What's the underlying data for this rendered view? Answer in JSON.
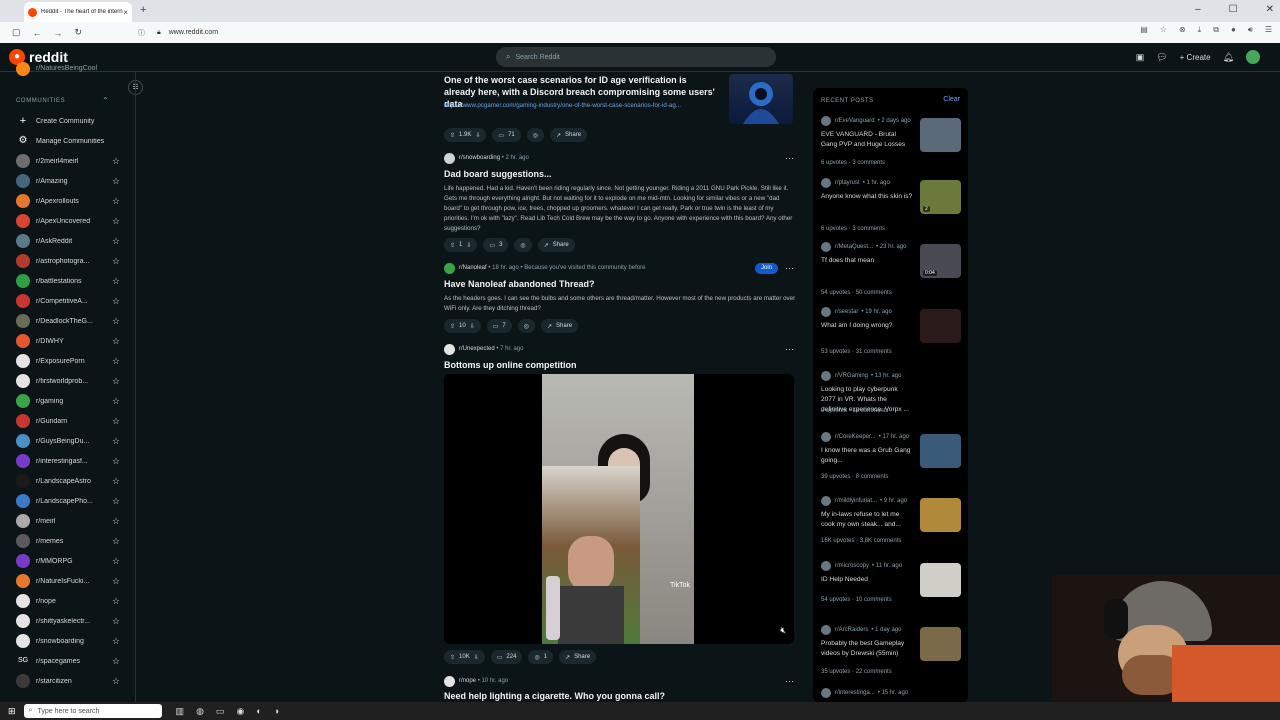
{
  "browser": {
    "tab_title": "Reddit - The heart of the intern",
    "tab_close": "×",
    "new_tab": "+",
    "url": "www.reddit.com",
    "window_buttons": [
      "–",
      "☐",
      "✕"
    ]
  },
  "header": {
    "logo_text": "reddit",
    "search_placeholder": "Search Reddit",
    "create_label": "Create",
    "notification_count": "1"
  },
  "sidebar": {
    "cut_item": "r/NaturesBeingCool",
    "section_label": "COMMUNITIES",
    "create_community": "Create Community",
    "manage_communities": "Manage Communities",
    "communities": [
      {
        "name": "r/2meirl4meirl",
        "color": "#6d6d6d",
        "glyph": ""
      },
      {
        "name": "r/Amazing",
        "color": "#46667a",
        "glyph": ""
      },
      {
        "name": "r/Apexrollouts",
        "color": "#e8772e",
        "glyph": ""
      },
      {
        "name": "r/ApexUncovered",
        "color": "#d64532",
        "glyph": ""
      },
      {
        "name": "r/AskReddit",
        "color": "#5a7a8a",
        "glyph": ""
      },
      {
        "name": "r/astrophotogra...",
        "color": "#b33b2c",
        "glyph": ""
      },
      {
        "name": "r/battlestations",
        "color": "#2ea043",
        "glyph": ""
      },
      {
        "name": "r/CompetitiveA...",
        "color": "#c8372d",
        "glyph": ""
      },
      {
        "name": "r/DeadlockTheG...",
        "color": "#6b6b5a",
        "glyph": ""
      },
      {
        "name": "r/DIWHY",
        "color": "#e8562e",
        "glyph": ""
      },
      {
        "name": "r/ExposurePorn",
        "color": "#e4e4e4",
        "glyph": ""
      },
      {
        "name": "r/firstworldprob...",
        "color": "#e4e4e4",
        "glyph": ""
      },
      {
        "name": "r/gaming",
        "color": "#3aa547",
        "glyph": ""
      },
      {
        "name": "r/Gundam",
        "color": "#c8372d",
        "glyph": ""
      },
      {
        "name": "r/GuysBeingDu...",
        "color": "#4a90c8",
        "glyph": ""
      },
      {
        "name": "r/interestingasf...",
        "color": "#7a3ac8",
        "glyph": ""
      },
      {
        "name": "r/LandscapeAstro",
        "color": "#1a1a1a",
        "glyph": ""
      },
      {
        "name": "r/LandscapePho...",
        "color": "#3a7ac8",
        "glyph": ""
      },
      {
        "name": "r/meirl",
        "color": "#aaaaaa",
        "glyph": ""
      },
      {
        "name": "r/memes",
        "color": "#5a5a5a",
        "glyph": ""
      },
      {
        "name": "r/MMORPG",
        "color": "#7a3ac8",
        "glyph": ""
      },
      {
        "name": "r/NatureIsFucki...",
        "color": "#e8772e",
        "glyph": ""
      },
      {
        "name": "r/nope",
        "color": "#e4e4e4",
        "glyph": ""
      },
      {
        "name": "r/shittyaskelectr...",
        "color": "#e4e4e4",
        "glyph": ""
      },
      {
        "name": "r/snowboarding",
        "color": "#e4e4e4",
        "glyph": ""
      },
      {
        "name": "r/spacegames",
        "color": "#0b1416",
        "glyph": "SG"
      },
      {
        "name": "r/starcitizen",
        "color": "#3a3a3a",
        "glyph": ""
      }
    ]
  },
  "feed": {
    "posts": [
      {
        "title": "One of the worst case scenarios for ID age verification is already here, with a Discord breach compromising some users' data",
        "link": "https://www.pcgamer.com/gaming-industry/one-of-the-worst-case-scenarios-for-id-ag...",
        "votes": "1.9K",
        "comments": "71",
        "share": "Share"
      },
      {
        "sub": "r/snowboarding",
        "time": "• 2 hr. ago",
        "title": "Dad board suggestions...",
        "body": "Life happened. Had a kid. Haven't been riding regularly since. Not getting younger. Riding a 2011 GNU Park Pickle. Still like it. Gets me through everything alright. But not waiting for it to explode on me mid-mtn. Looking for similar vibes or a new \"dad board\" to get through pow, ice, trees, chopped up groomers. whatever I can get really. Park or true twin is the least of my priorities. I'm ok with \"lazy\". Read Lib Tech Cold Brew may be the way to go. Anyone with experience with this board? Any other suggestions?",
        "votes": "1",
        "comments": "3",
        "share": "Share"
      },
      {
        "sub": "r/Nanoleaf",
        "time": "• 18 hr. ago • Because you've visited this community before",
        "join": "Join",
        "title": "Have Nanoleaf abandoned Thread?",
        "body": "As the headers goes. I can see the bulbs and some others are thread/matter. However most of the new products are matter over WiFi only. Are they ditching thread?",
        "votes": "10",
        "comments": "7",
        "share": "Share"
      },
      {
        "sub": "r/Unexpected",
        "time": "• 7 hr. ago",
        "title": "Bottoms up online competition",
        "tiktok": "TikTok",
        "votes": "10K",
        "comments": "224",
        "award": "1",
        "share": "Share"
      },
      {
        "sub": "r/nope",
        "time": "• 10 hr. ago",
        "title": "Need help lighting a cigarette. Who you gonna call?"
      }
    ]
  },
  "recent": {
    "heading": "RECENT POSTS",
    "clear": "Clear",
    "items": [
      {
        "sub": "r/EveVanguard",
        "time": "• 2 days ago",
        "title": "EVE VANGUARD - Brutal Gang PVP and Huge Losses",
        "upvotes": "6 upvotes",
        "comments": "3 comments",
        "thumb": "#5a6a78"
      },
      {
        "sub": "r/playrust",
        "time": "• 1 hr. ago",
        "title": "Anyone know what this skin is?",
        "upvotes": "6 upvotes",
        "comments": "3 comments",
        "thumb": "#6b7a3a",
        "badge": "2"
      },
      {
        "sub": "r/MetaQuest...",
        "time": "• 23 hr. ago",
        "title": "Tf does that mean",
        "upvotes": "54 upvotes",
        "comments": "50 comments",
        "thumb": "#4a4a55",
        "badge": "0:04"
      },
      {
        "sub": "r/seestar",
        "time": "• 19 hr. ago",
        "title": "What am I doing wrong?",
        "upvotes": "53 upvotes",
        "comments": "31 comments",
        "thumb": "#2a1a1a"
      },
      {
        "sub": "r/VRGaming",
        "time": "• 13 hr. ago",
        "title": "Looking to play cyberpunk 2077 in VR. Whats the definitive experience. Vorpx ...",
        "upvotes": "2 upvotes",
        "comments": "16 comments"
      },
      {
        "sub": "r/CoreKeeper...",
        "time": "• 17 hr. ago",
        "title": "I know there was a Grub Gang going...",
        "upvotes": "39 upvotes",
        "comments": "8 comments",
        "thumb": "#3a5a7a"
      },
      {
        "sub": "r/mildlyinfuriat...",
        "time": "• 9 hr. ago",
        "title": "My in-laws refuse to let me cook my own steak... and...",
        "upvotes": "16K upvotes",
        "comments": "3.8K comments",
        "thumb": "#b08a3a"
      },
      {
        "sub": "r/microscopy",
        "time": "• 11 hr. ago",
        "title": "ID Help Needed",
        "upvotes": "54 upvotes",
        "comments": "10 comments",
        "thumb": "#cfcfc8"
      },
      {
        "sub": "r/ArcRaiders",
        "time": "• 1 day ago",
        "title": "Probably the best Gameplay videos by Drewski (55min)",
        "upvotes": "35 upvotes",
        "comments": "22 comments",
        "thumb": "#7a6a4a"
      },
      {
        "sub": "r/interestinga...",
        "time": "• 15 hr. ago",
        "title": "",
        "upvotes": "",
        "comments": ""
      }
    ]
  },
  "taskbar": {
    "search_placeholder": "Type here to search"
  }
}
